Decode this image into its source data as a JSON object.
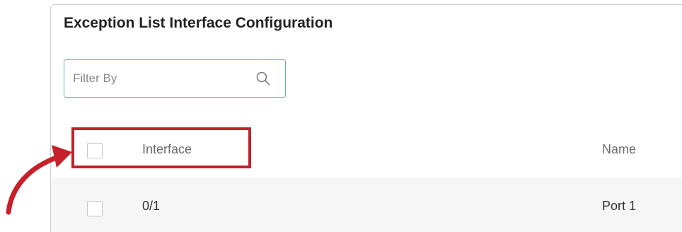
{
  "panel": {
    "title": "Exception List Interface Configuration"
  },
  "filter": {
    "placeholder": "Filter By",
    "value": "",
    "icon": "search-icon"
  },
  "table": {
    "columns": [
      {
        "key": "interface",
        "label": "Interface"
      },
      {
        "key": "name",
        "label": "Name"
      }
    ],
    "rows": [
      {
        "interface": "0/1",
        "name": "Port 1",
        "checked": false
      }
    ],
    "select_all_checked": false
  },
  "annotation": {
    "highlight_color": "#c6202a",
    "arrow_color": "#c6202a"
  }
}
